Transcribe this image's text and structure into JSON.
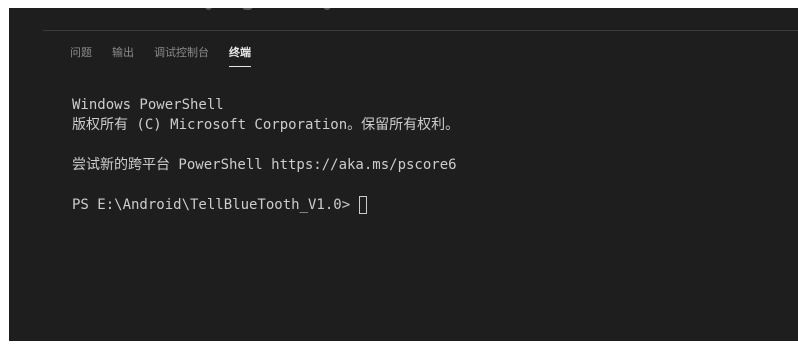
{
  "panel": {
    "tabs": [
      {
        "label": "问题",
        "active": false
      },
      {
        "label": "输出",
        "active": false
      },
      {
        "label": "调试控制台",
        "active": false
      },
      {
        "label": "终端",
        "active": true
      }
    ]
  },
  "terminal": {
    "lines": [
      "Windows PowerShell",
      "版权所有 (C) Microsoft Corporation。保留所有权利。",
      "",
      "尝试新的跨平台 PowerShell https://aka.ms/pscore6",
      ""
    ],
    "prompt": "PS E:\\Android\\TellBlueTooth_V1.0>"
  },
  "colors": {
    "background": "#1e1e1e",
    "text": "#cccccc",
    "tab_inactive": "#8b8b8b",
    "tab_active": "#e7e7e7"
  }
}
